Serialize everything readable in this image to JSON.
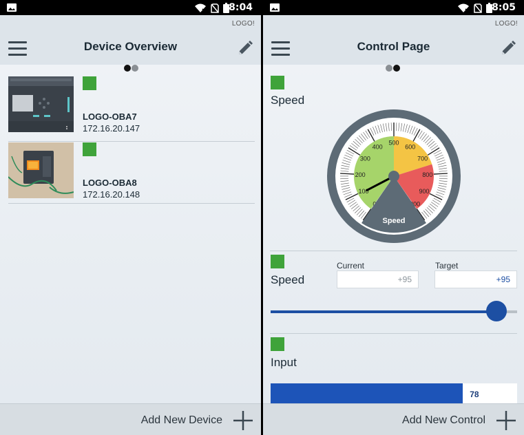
{
  "left": {
    "status_time": "8:04",
    "brand": "LOGO!",
    "title": "Device Overview",
    "pager": [
      "on",
      "off"
    ],
    "devices": [
      {
        "name": "LOGO-OBA7",
        "ip": "172.16.20.147",
        "status_color": "#3fa33a"
      },
      {
        "name": "LOGO-OBA8",
        "ip": "172.16.20.148",
        "status_color": "#3fa33a"
      }
    ],
    "footer_label": "Add New Device"
  },
  "right": {
    "status_time": "8:05",
    "brand": "LOGO!",
    "title": "Control Page",
    "pager": [
      "off",
      "on"
    ],
    "gauge": {
      "label": "Speed",
      "center_label": "Speed",
      "ticks": [
        "0",
        "100",
        "200",
        "300",
        "400",
        "500",
        "600",
        "700",
        "800",
        "900",
        "1000"
      ],
      "min": 0,
      "max": 1000,
      "value": 95,
      "bands": [
        {
          "from": 0,
          "to": 500,
          "color": "#a6d46a"
        },
        {
          "from": 500,
          "to": 750,
          "color": "#f4c444"
        },
        {
          "from": 750,
          "to": 1000,
          "color": "#e85b5b"
        }
      ]
    },
    "speed_control": {
      "label": "Speed",
      "current_label": "Current",
      "target_label": "Target",
      "current_value": "+95",
      "target_value": "+95",
      "slider_fraction": 0.915
    },
    "input_control": {
      "label": "Input",
      "value": "78",
      "fraction": 0.78
    },
    "footer_label": "Add New Control"
  },
  "colors": {
    "accent": "#1d4fa3",
    "status_ok": "#3fa33a",
    "header_bg": "#dde4ea"
  }
}
